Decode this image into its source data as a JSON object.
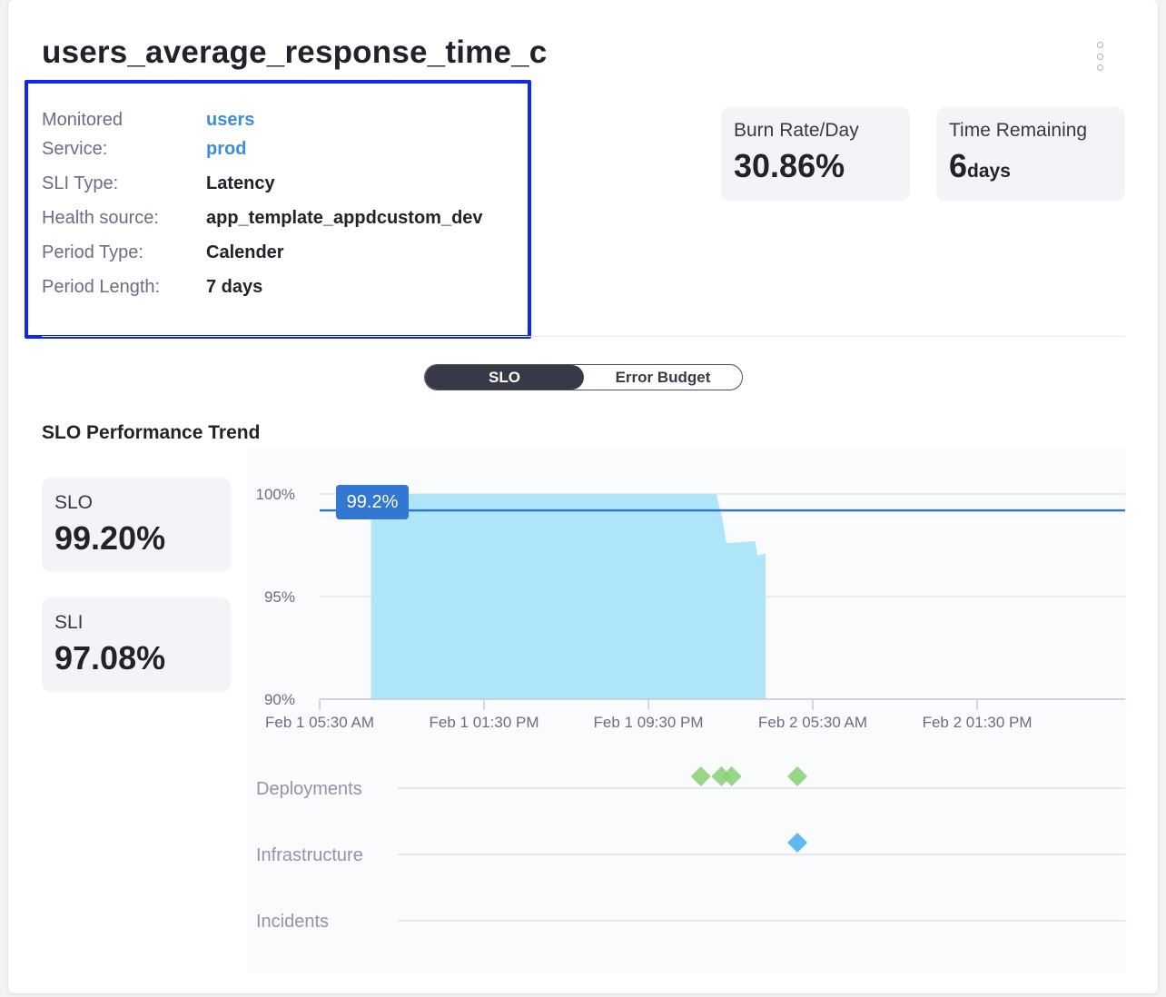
{
  "title": "users_average_response_time_c",
  "details": {
    "monitored_service_label_1": "Monitored",
    "monitored_service_label_2": "Service:",
    "service_name": "users",
    "environment": "prod",
    "sli_type_label": "SLI Type:",
    "sli_type": "Latency",
    "health_source_label": "Health source:",
    "health_source": "app_template_appdcustom_dev",
    "period_type_label": "Period Type:",
    "period_type": "Calender",
    "period_length_label": "Period Length:",
    "period_length": "7 days"
  },
  "stats": {
    "burn_rate_label": "Burn Rate/Day",
    "burn_rate_value": "30.86%",
    "time_remaining_label": "Time Remaining",
    "time_remaining_value": "6",
    "time_remaining_unit": "days"
  },
  "toggle": {
    "active": "SLO",
    "inactive": "Error Budget"
  },
  "trend_title": "SLO Performance Trend",
  "summary": {
    "slo_label": "SLO",
    "slo_value": "99.20%",
    "sli_label": "SLI",
    "sli_value": "97.08%"
  },
  "timeline_rows": [
    "Deployments",
    "Infrastructure",
    "Incidents"
  ],
  "colors": {
    "area": "#aee5f9",
    "target_line": "#3277d2",
    "deployment": "#8ed27a",
    "infrastructure": "#5fb8ee",
    "highlight_border": "#0f27f5"
  },
  "chart_data": {
    "type": "area",
    "y_ticks": [
      "100%",
      "95%",
      "90%"
    ],
    "ylim": [
      90,
      100
    ],
    "x_ticks": [
      "Feb 1 05:30 AM",
      "Feb 1 01:30 PM",
      "Feb 1 09:30 PM",
      "Feb 2 05:30 AM",
      "Feb 2 01:30 PM"
    ],
    "target": 99.2,
    "target_label": "99.2%",
    "series": [
      {
        "x_hours": [
          8,
          24.8,
          25.0,
          25.1,
          25.3,
          26.7,
          26.8,
          27.2
        ],
        "values": [
          100,
          100,
          99.2,
          98.8,
          97.6,
          97.7,
          97.0,
          97.1
        ]
      }
    ],
    "deployment_hours": [
      24.05,
      25.05,
      25.55,
      28.75
    ],
    "infrastructure_hours": [
      28.75
    ]
  }
}
